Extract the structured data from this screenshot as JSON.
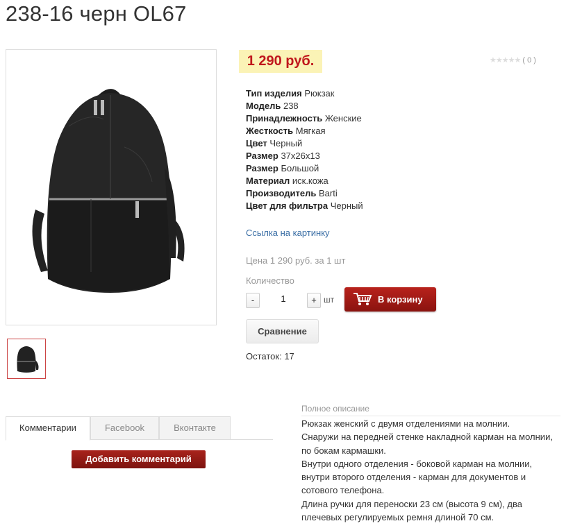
{
  "product": {
    "title": "238-16 черн OL67",
    "price": "1 290 руб.",
    "rating_stars": "★★★★★",
    "rating_count": "( 0 )",
    "specs": [
      {
        "label": "Тип изделия",
        "value": "Рюкзак"
      },
      {
        "label": "Модель",
        "value": "238"
      },
      {
        "label": "Принадлежность",
        "value": "Женские"
      },
      {
        "label": "Жесткость",
        "value": "Мягкая"
      },
      {
        "label": "Цвет",
        "value": "Черный"
      },
      {
        "label": "Размер",
        "value": "37x26x13"
      },
      {
        "label": "Размер",
        "value": "Большой"
      },
      {
        "label": "Материал",
        "value": "иск.кожа"
      },
      {
        "label": "Производитель",
        "value": "Barti"
      },
      {
        "label": "Цвет для фильтра",
        "value": "Черный"
      }
    ],
    "image_link": "Ссылка на картинку",
    "unit_price": "Цена 1 290 руб. за 1 шт",
    "quantity_label": "Количество",
    "quantity_value": "1",
    "minus": "-",
    "plus": "+",
    "unit": "шт",
    "cart_button": "В корзину",
    "compare_button": "Сравнение",
    "stock": "Остаток: 17"
  },
  "tabs": [
    {
      "label": "Комментарии"
    },
    {
      "label": "Facebook"
    },
    {
      "label": "Вконтакте"
    }
  ],
  "add_comment_button": "Добавить комментарий",
  "description": {
    "title": "Полное описание",
    "lines": [
      "Рюкзак женский с двумя отделениями на молнии.",
      "Снаружи на передней стенке накладной карман на молнии, по бокам кармашки.",
      "Внутри одного отделения - боковой карман на молнии, внутри второго отделения - карман для документов и сотового телефона.",
      "Длина ручки для переноски 23 см (высота 9 см), два плечевых регулируемых ремня длиной 70 см."
    ]
  },
  "colors": {
    "price": "#c0161c",
    "price_bg": "#fbf3b6",
    "cart_button": "#9e1a15",
    "link": "#3a6ea5"
  }
}
